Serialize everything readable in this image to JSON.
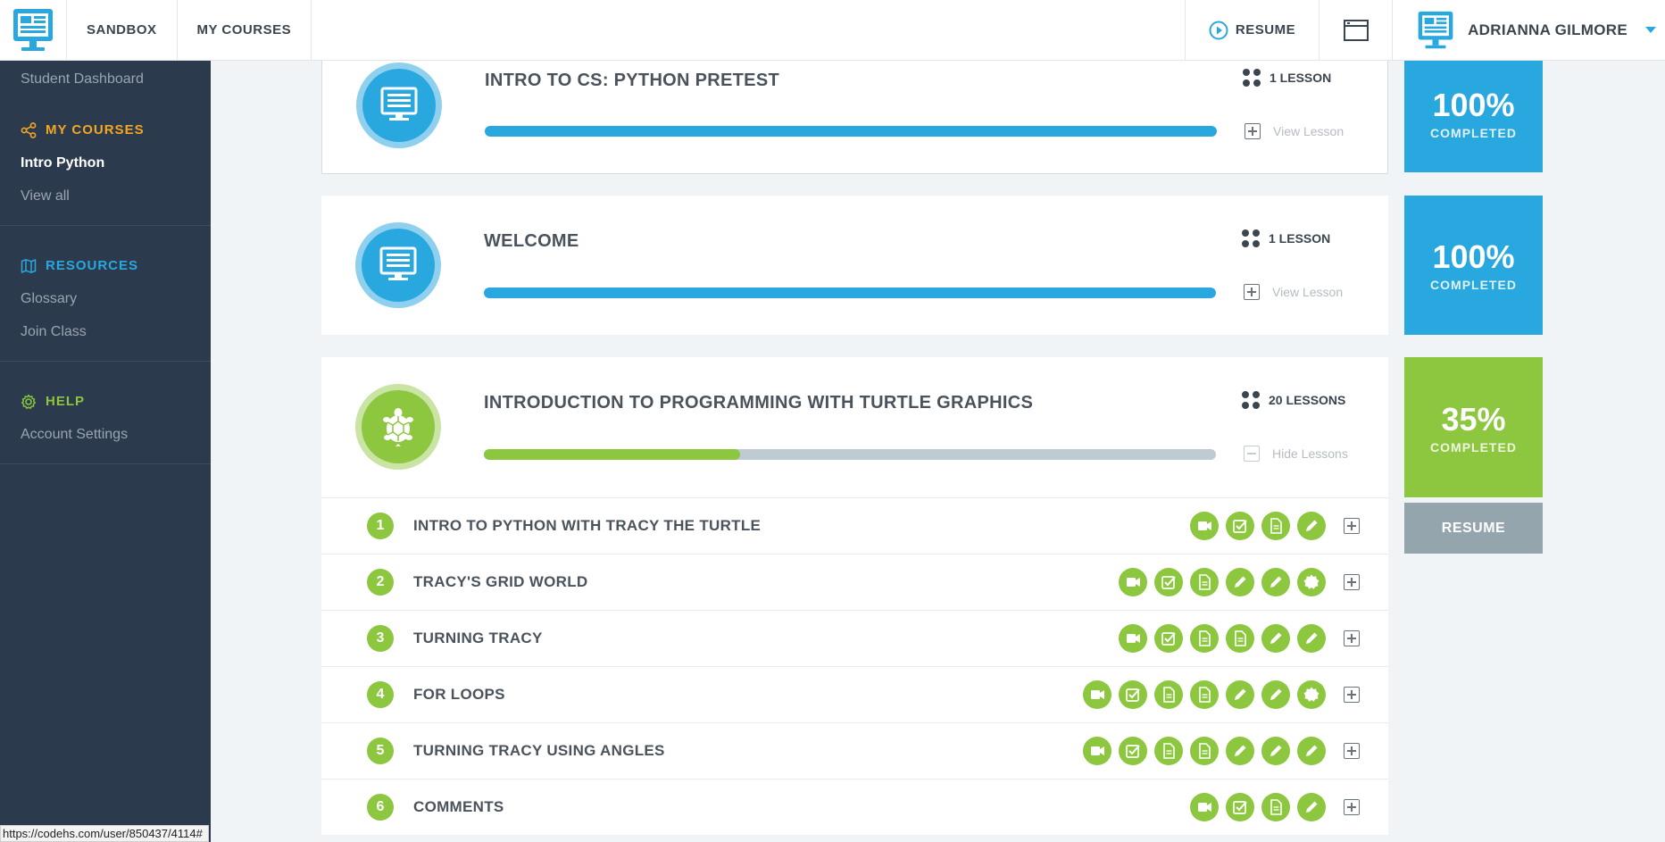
{
  "topbar": {
    "nav": [
      "SANDBOX",
      "MY COURSES"
    ],
    "resume_label": "RESUME",
    "user_name": "ADRIANNA GILMORE"
  },
  "sidebar": {
    "dashboard": "Student Dashboard",
    "my_courses_head": "MY COURSES",
    "course_active": "Intro Python",
    "view_all": "View all",
    "resources_head": "RESOURCES",
    "glossary": "Glossary",
    "join_class": "Join Class",
    "help_head": "HELP",
    "account_settings": "Account Settings",
    "colors": {
      "my_courses": "#f5a623",
      "resources": "#29a8e0",
      "help": "#8dc63f"
    }
  },
  "modules": [
    {
      "title": "INTRO TO CS: PYTHON PRETEST",
      "lessons": "1 LESSON",
      "toggle": "View Lesson",
      "progress": 1.0,
      "pct": "100%",
      "pct_label": "COMPLETED",
      "color": "#29a8e0"
    },
    {
      "title": "WELCOME",
      "lessons": "1 LESSON",
      "toggle": "View Lesson",
      "progress": 1.0,
      "pct": "100%",
      "pct_label": "COMPLETED",
      "color": "#29a8e0"
    },
    {
      "title": "INTRODUCTION TO PROGRAMMING WITH TURTLE GRAPHICS",
      "lessons": "20 LESSONS",
      "toggle": "Hide Lessons",
      "progress": 0.35,
      "pct": "35%",
      "pct_label": "COMPLETED",
      "color": "#8dc63f",
      "resume": "RESUME"
    }
  ],
  "lessons": [
    {
      "num": "1",
      "title": "INTRO TO PYTHON WITH TRACY THE TURTLE",
      "activities": [
        "video-icon",
        "check-icon",
        "document-icon",
        "pencil-icon"
      ]
    },
    {
      "num": "2",
      "title": "TRACY'S GRID WORLD",
      "activities": [
        "video-icon",
        "check-icon",
        "document-icon",
        "pencil-icon",
        "pencil-icon",
        "badge-icon"
      ]
    },
    {
      "num": "3",
      "title": "TURNING TRACY",
      "activities": [
        "video-icon",
        "check-icon",
        "document-icon",
        "document-icon",
        "pencil-icon",
        "pencil-icon"
      ]
    },
    {
      "num": "4",
      "title": "FOR LOOPS",
      "activities": [
        "video-icon",
        "check-icon",
        "document-icon",
        "document-icon",
        "pencil-icon",
        "pencil-icon",
        "badge-icon"
      ]
    },
    {
      "num": "5",
      "title": "TURNING TRACY USING ANGLES",
      "activities": [
        "video-icon",
        "check-icon",
        "document-icon",
        "document-icon",
        "pencil-icon",
        "pencil-icon",
        "pencil-icon"
      ]
    },
    {
      "num": "6",
      "title": "COMMENTS",
      "activities": [
        "video-icon",
        "check-icon",
        "document-icon",
        "pencil-icon"
      ]
    }
  ],
  "status_url": "https://codehs.com/user/850437/4114#"
}
